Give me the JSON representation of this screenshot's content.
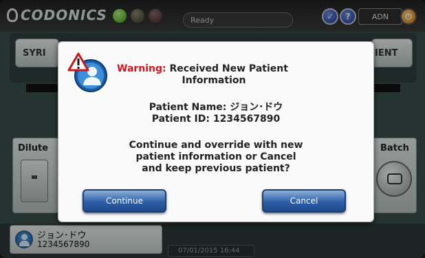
{
  "header": {
    "logo_text": "CODONICS",
    "status_text": "Ready",
    "user": "ADN",
    "help_icon": "help-icon",
    "info_icon": "info-icon",
    "logout_icon": "logout-icon"
  },
  "tabs": {
    "left_label": "SYRI",
    "right_label": "IENT"
  },
  "side": {
    "left_label": "Dilute",
    "right_label": "Batch"
  },
  "patient": {
    "name": "ジョン･ドウ",
    "id": "1234567890"
  },
  "datetime": "07/01/2015 16:44",
  "dialog": {
    "warning_label": "Warning:",
    "title_line1": "Received New Patient",
    "title_line2": "Information",
    "patient_name_line": "Patient Name: ジョン･ドウ",
    "patient_id_line": "Patient ID:   1234567890",
    "message_line1": "Continue and override with new",
    "message_line2": "patient information or Cancel",
    "message_line3": "and keep previous patient?",
    "continue_label": "Continue",
    "cancel_label": "Cancel"
  },
  "colors": {
    "warning": "#d4141c",
    "button_blue": "#2d5fa7",
    "status_green": "#3a9a16"
  }
}
